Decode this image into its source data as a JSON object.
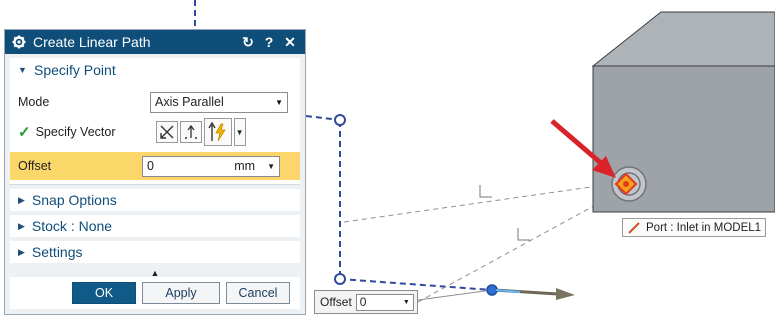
{
  "dialog": {
    "title": "Create Linear Path",
    "specify_point": "Specify Point",
    "mode_label": "Mode",
    "mode_value": "Axis Parallel",
    "specify_vector_label": "Specify Vector",
    "offset_label": "Offset",
    "offset_value": "0",
    "offset_unit": "mm",
    "snap_options": "Snap Options",
    "stock": "Stock : None",
    "settings": "Settings",
    "ok": "OK",
    "apply": "Apply",
    "cancel": "Cancel"
  },
  "viewport": {
    "offset_popup_label": "Offset",
    "offset_popup_value": "0",
    "tooltip": "Port : Inlet in MODEL1"
  },
  "colors": {
    "title_bar": "#0f4e78",
    "highlight": "#fcd56c",
    "path": "#2f4a9e",
    "arrow": "#d9232a",
    "box": "#9ea3a8"
  }
}
